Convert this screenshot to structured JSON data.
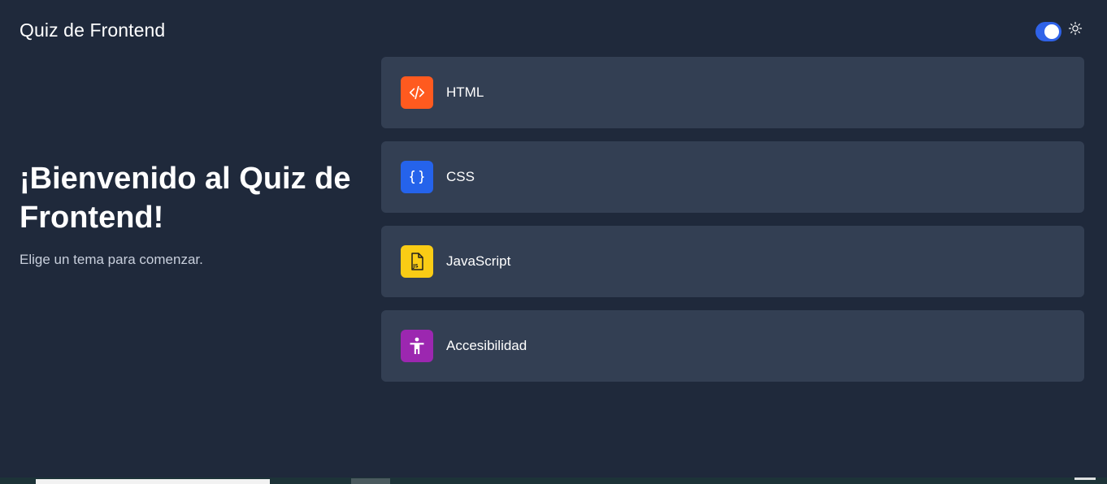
{
  "header": {
    "title": "Quiz de Frontend",
    "theme_toggle_on": true,
    "theme_icon": "sun-icon"
  },
  "hero": {
    "title": "¡Bienvenido al Quiz de Frontend!",
    "subtitle": "Elige un tema para comenzar."
  },
  "topics": [
    {
      "label": "HTML",
      "icon": "code-icon",
      "color": "#ff5a1f"
    },
    {
      "label": "CSS",
      "icon": "braces-icon",
      "color": "#2563eb"
    },
    {
      "label": "JavaScript",
      "icon": "js-file-icon",
      "color": "#facc15"
    },
    {
      "label": "Accesibilidad",
      "icon": "accessibility-icon",
      "color": "#9c27b0"
    }
  ],
  "colors": {
    "background": "#1f293b",
    "card": "#333f53",
    "toggle": "#2f62e8",
    "subtitle_text": "#c8cfdc"
  }
}
